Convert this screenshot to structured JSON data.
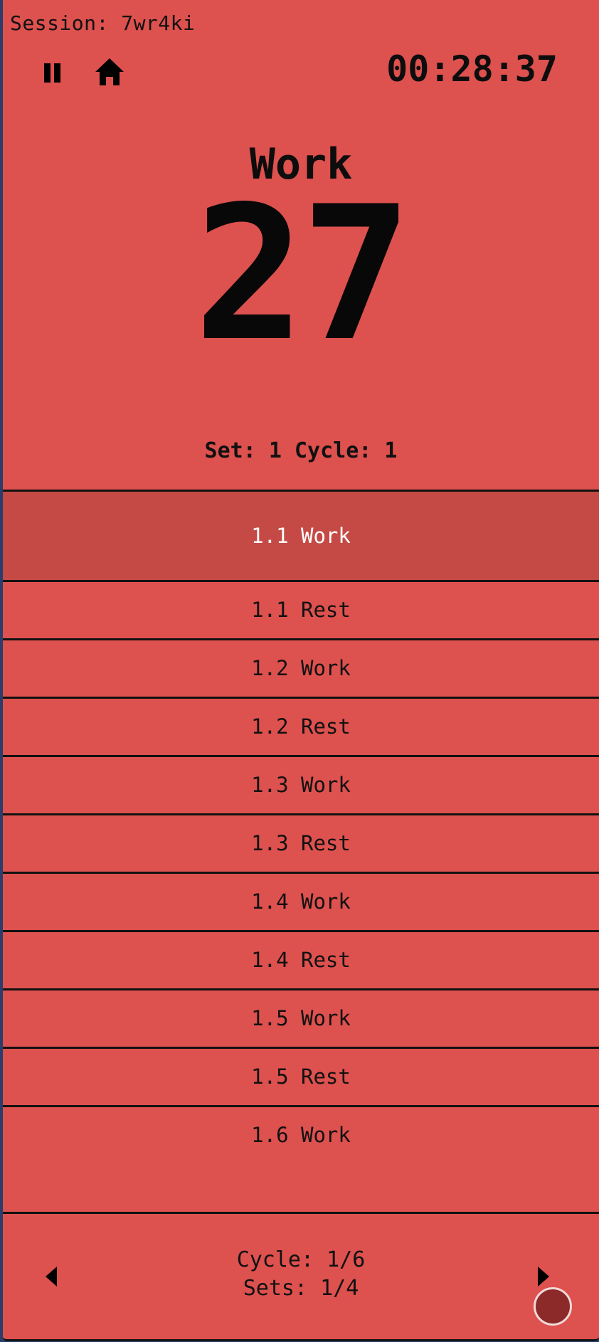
{
  "header": {
    "session_label": "Session: 7wr4ki",
    "elapsed": "00:28:37"
  },
  "icons": {
    "pause": "pause-icon",
    "home": "home-icon",
    "prev": "triangle-left-icon",
    "next": "triangle-right-icon"
  },
  "timer": {
    "phase": "Work",
    "count": "27",
    "set_cycle": "Set: 1 Cycle: 1"
  },
  "intervals": [
    {
      "label": "1.1 Work",
      "active": true
    },
    {
      "label": "1.1 Rest"
    },
    {
      "label": "1.2 Work"
    },
    {
      "label": "1.2 Rest"
    },
    {
      "label": "1.3 Work"
    },
    {
      "label": "1.3 Rest"
    },
    {
      "label": "1.4 Work"
    },
    {
      "label": "1.4 Rest"
    },
    {
      "label": "1.5 Work"
    },
    {
      "label": "1.5 Rest"
    },
    {
      "label": "1.6 Work"
    }
  ],
  "footer": {
    "cycle": "Cycle: 1/6",
    "sets": "Sets: 1/4"
  },
  "colors": {
    "background": "#dd514e",
    "active_row": "#c54a45",
    "record_button": "#8c2a2a"
  }
}
